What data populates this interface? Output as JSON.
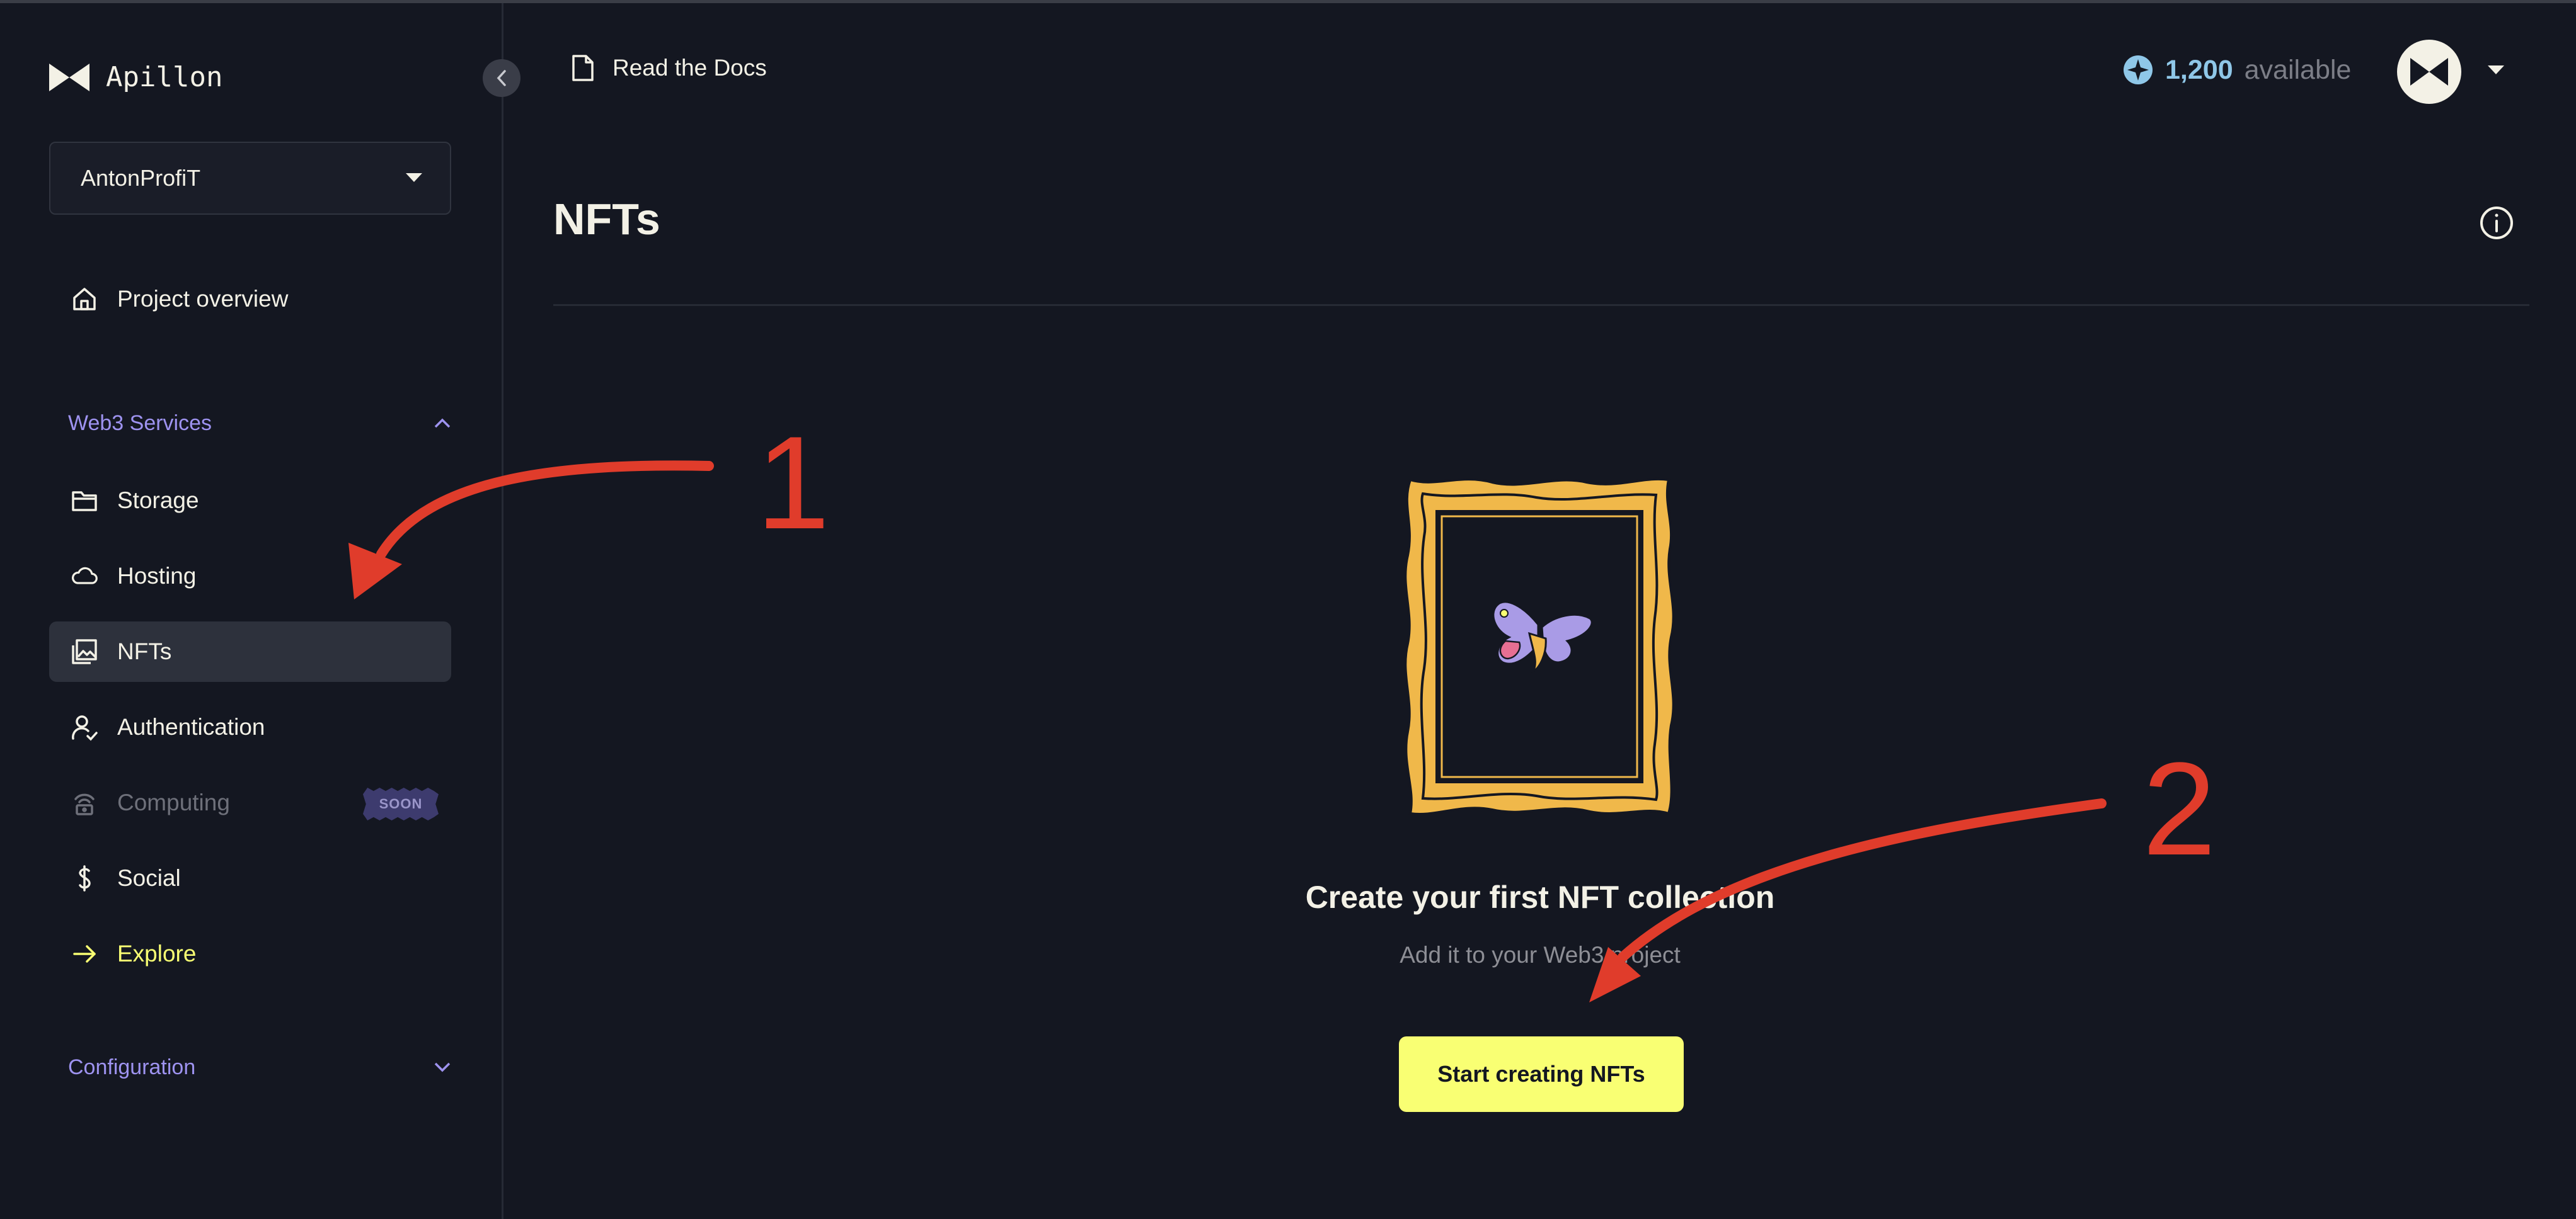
{
  "app": {
    "name": "Apillon"
  },
  "sidebar": {
    "project": "AntonProfiT",
    "overview": "Project overview",
    "web3_section": "Web3 Services",
    "items": [
      {
        "label": "Storage"
      },
      {
        "label": "Hosting"
      },
      {
        "label": "NFTs"
      },
      {
        "label": "Authentication"
      },
      {
        "label": "Computing",
        "badge": "SOON"
      },
      {
        "label": "Social"
      },
      {
        "label": "Explore"
      }
    ],
    "config_section": "Configuration"
  },
  "header": {
    "docs": "Read the Docs",
    "credits_amount": "1,200",
    "credits_label": "available"
  },
  "main": {
    "title": "NFTs",
    "empty_title": "Create your first NFT collection",
    "empty_subtitle": "Add it to your Web3 project",
    "cta": "Start creating NFTs"
  },
  "annotations": [
    "1",
    "2"
  ],
  "colors": {
    "background": "#141721",
    "accent_yellow": "#f9ff73",
    "section_purple": "#9e93f0",
    "annotation_red": "#e03c2b",
    "frame_gold": "#f0b84a"
  }
}
